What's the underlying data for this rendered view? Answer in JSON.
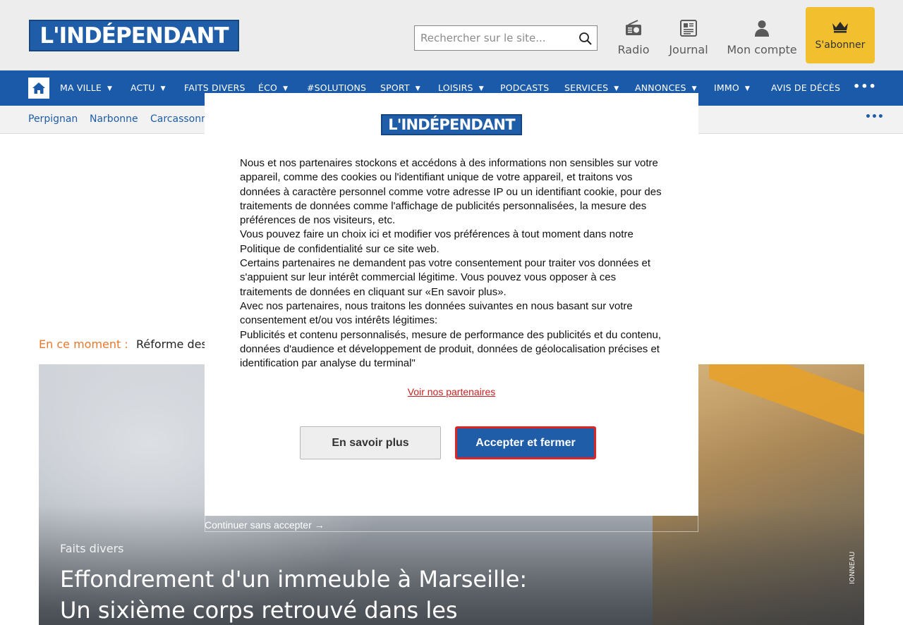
{
  "header": {
    "logo_text": "L'INDÉPENDANT",
    "search_placeholder": "Rechercher sur le site...",
    "radio_label": "Radio",
    "journal_label": "Journal",
    "account_label": "Mon compte",
    "subscribe_label": "S'abonner"
  },
  "nav": {
    "items": [
      {
        "label": "MA VILLE",
        "caret": "▼"
      },
      {
        "label": "ACTU",
        "caret": "▼"
      },
      {
        "label": "FAITS DIVERS"
      },
      {
        "label": "ÉCO",
        "caret": "▼"
      },
      {
        "label": "#SOLUTIONS"
      },
      {
        "label": "SPORT",
        "caret": "▼"
      },
      {
        "label": "LOISIRS",
        "caret": "▼"
      },
      {
        "label": "PODCASTS"
      },
      {
        "label": "SERVICES",
        "caret": "▼"
      },
      {
        "label": "ANNONCES",
        "caret": "▼"
      },
      {
        "label": "IMMO",
        "caret": "▼"
      },
      {
        "label": "AVIS DE DÉCÈS"
      }
    ],
    "more": "•••"
  },
  "subnav": {
    "items": [
      "Perpignan",
      "Narbonne",
      "Carcassonne"
    ],
    "more": "•••"
  },
  "trending": {
    "label": "En ce moment :",
    "text": "Réforme des"
  },
  "hero": {
    "category": "Faits divers",
    "title": "Effondrement d'un immeuble à Marseille: Un sixième corps retrouvé dans les",
    "credit": "IONNEAU"
  },
  "consent": {
    "logo_text": "L'INDÉPENDANT",
    "paragraphs": [
      "Nous et nos partenaires stockons et accédons à des informations non sensibles sur votre appareil, comme des cookies ou l'identifiant unique de votre appareil, et traitons vos données à caractère personnel comme votre adresse IP ou un identifiant cookie, pour des traitements de données comme l'affichage de publicités personnalisées, la mesure des préférences de nos visiteurs, etc.",
      "Vous pouvez faire un choix ici et modifier vos préférences à tout moment dans notre Politique de confidentialité sur ce site web.",
      "Certains partenaires ne demandent pas votre consentement pour traiter vos données et s'appuient sur leur intérêt commercial légitime. Vous pouvez vous opposer à ces traitements de données en cliquant sur «En savoir plus».",
      "Avec nos partenaires, nous traitons les données suivantes en nous basant sur votre consentement et/ou vos intérêts légitimes:",
      "Publicités et contenu personnalisés, mesure de performance des publicités et du contenu, données d'audience et développement de produit, données de géolocalisation précises et identification par analyse du terminal\""
    ],
    "partners_link": "Voir nos partenaires",
    "more_button": "En savoir plus",
    "accept_button": "Accepter et fermer",
    "continue_link": "Continuer sans accepter →"
  },
  "colors": {
    "brand_blue": "#1b5aa8",
    "subscribe_yellow": "#f2c02f",
    "trending_orange": "#e8782b",
    "accept_border_red": "#e02424",
    "link_red": "#cc1f1f"
  }
}
